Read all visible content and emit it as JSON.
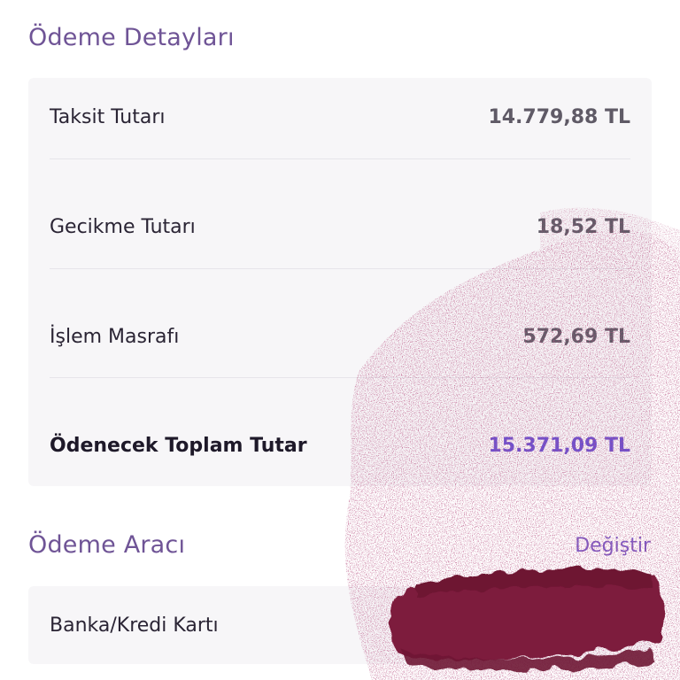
{
  "payment_details": {
    "title": "Ödeme Detayları",
    "rows": [
      {
        "label": "Taksit Tutarı",
        "value": "14.779,88 TL"
      },
      {
        "label": "Gecikme Tutarı",
        "value": "18,52 TL"
      },
      {
        "label": "İşlem Masrafı",
        "value": "572,69 TL"
      }
    ],
    "total": {
      "label": "Ödenecek Toplam Tutar",
      "value": "15.371,09 TL"
    }
  },
  "payment_tool": {
    "title": "Ödeme Aracı",
    "change_label": "Değiştir",
    "method_label": "Banka/Kredi Kartı"
  },
  "colors": {
    "heading": "#6f5496",
    "accent": "#6c4fd0",
    "card_bg": "#f7f6f8",
    "redaction": "#7d1a3c"
  }
}
